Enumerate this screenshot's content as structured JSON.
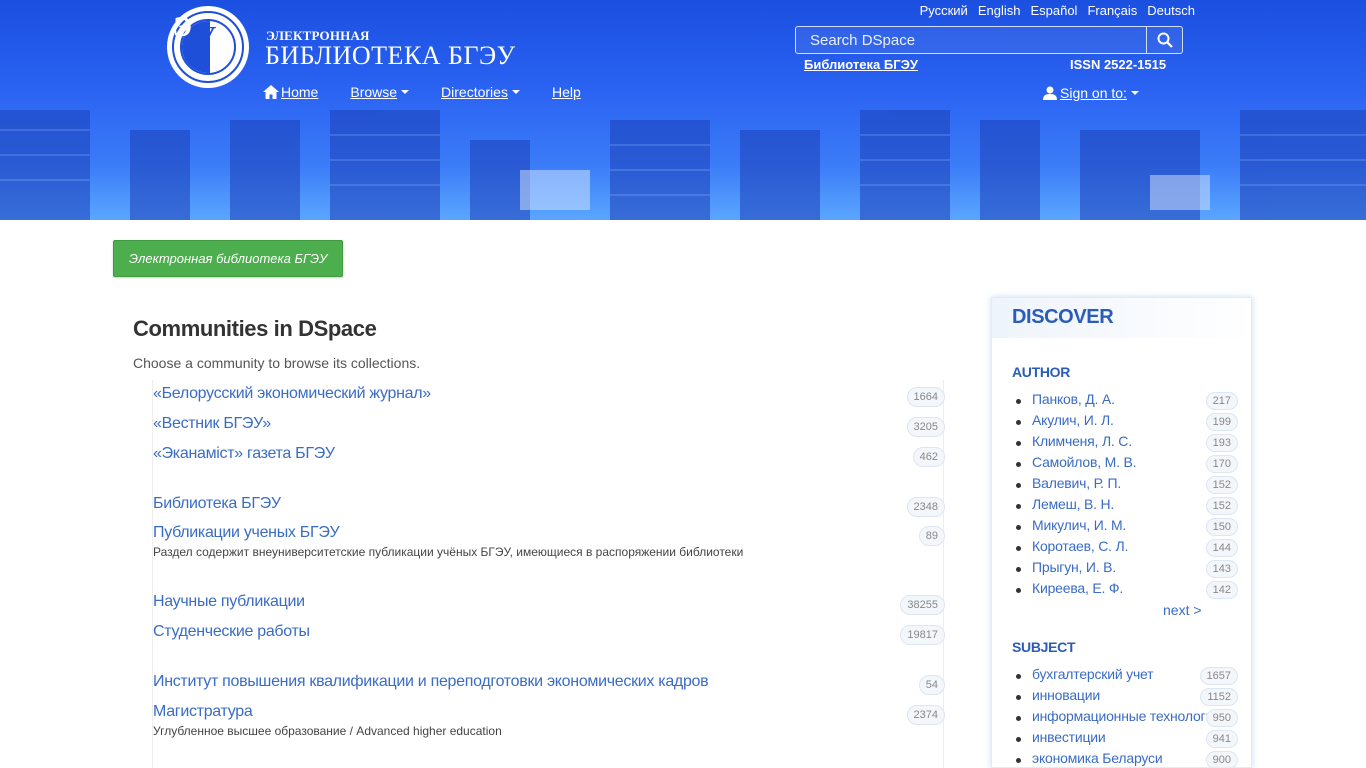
{
  "header": {
    "languages": [
      "Русский",
      "English",
      "Español",
      "Français",
      "Deutsch"
    ],
    "brand_small": "ЭЛЕКТРОННАЯ",
    "brand_big": "БИБЛИОТЕКА БГЭУ",
    "search_placeholder": "Search DSpace",
    "library_link": "Библиотека БГЭУ",
    "issn": "ISSN 2522-1515",
    "nav": {
      "home": "Home",
      "browse": "Browse",
      "directories": "Directories",
      "help": "Help"
    },
    "sign_on": "Sign on to:"
  },
  "breadcrumb": "Электронная библиотека БГЭУ",
  "main": {
    "title": "Communities in DSpace",
    "description": "Choose a community to browse its collections.",
    "communities": [
      {
        "name": "«Белорусский экономический журнал»",
        "count": "1664",
        "desc": ""
      },
      {
        "name": "«Вестник БГЭУ»",
        "count": "3205",
        "desc": ""
      },
      {
        "name": "«Эканаміст» газета БГЭУ",
        "count": "462",
        "desc": ""
      },
      {
        "name": "Библиотека БГЭУ",
        "count": "2348",
        "desc": ""
      },
      {
        "name": "Публикации ученых БГЭУ",
        "count": "89",
        "desc": "Раздел содержит внеуниверситетские публикации учёных БГЭУ, имеющиеся в распоряжении библиотеки"
      },
      {
        "name": "Научные публикации",
        "count": "38255",
        "desc": ""
      },
      {
        "name": "Студенческие работы",
        "count": "19817",
        "desc": ""
      },
      {
        "name": "Институт повышения квалификации и переподготовки экономических кадров",
        "count": "54",
        "desc": ""
      },
      {
        "name": "Магистратура",
        "count": "2374",
        "desc": "Углубленное высшее образование / Advanced higher education"
      }
    ]
  },
  "sidebar": {
    "title": "DISCOVER",
    "author_title": "AUTHOR",
    "authors": [
      {
        "name": "Панков, Д. А.",
        "count": "217"
      },
      {
        "name": "Акулич, И. Л.",
        "count": "199"
      },
      {
        "name": "Климченя, Л. С.",
        "count": "193"
      },
      {
        "name": "Самойлов, М. В.",
        "count": "170"
      },
      {
        "name": "Валевич, Р. П.",
        "count": "152"
      },
      {
        "name": "Лемеш, В. Н.",
        "count": "152"
      },
      {
        "name": "Микулич, И. М.",
        "count": "150"
      },
      {
        "name": "Коротаев, С. Л.",
        "count": "144"
      },
      {
        "name": "Прыгун, И. В.",
        "count": "143"
      },
      {
        "name": "Киреева, Е. Ф.",
        "count": "142"
      }
    ],
    "next": "next >",
    "subject_title": "SUBJECT",
    "subjects": [
      {
        "name": "бухгалтерский учет",
        "count": "1657"
      },
      {
        "name": "инновации",
        "count": "1152"
      },
      {
        "name": "информационные технологии",
        "count": "950"
      },
      {
        "name": "инвестиции",
        "count": "941"
      },
      {
        "name": "экономика Беларуси",
        "count": "900"
      }
    ]
  },
  "colors": {
    "header_blue": "#2a62f2",
    "link": "#3a6cc4",
    "breadcrumb_green": "#4cae4c",
    "discover_title": "#2a5cb8"
  }
}
